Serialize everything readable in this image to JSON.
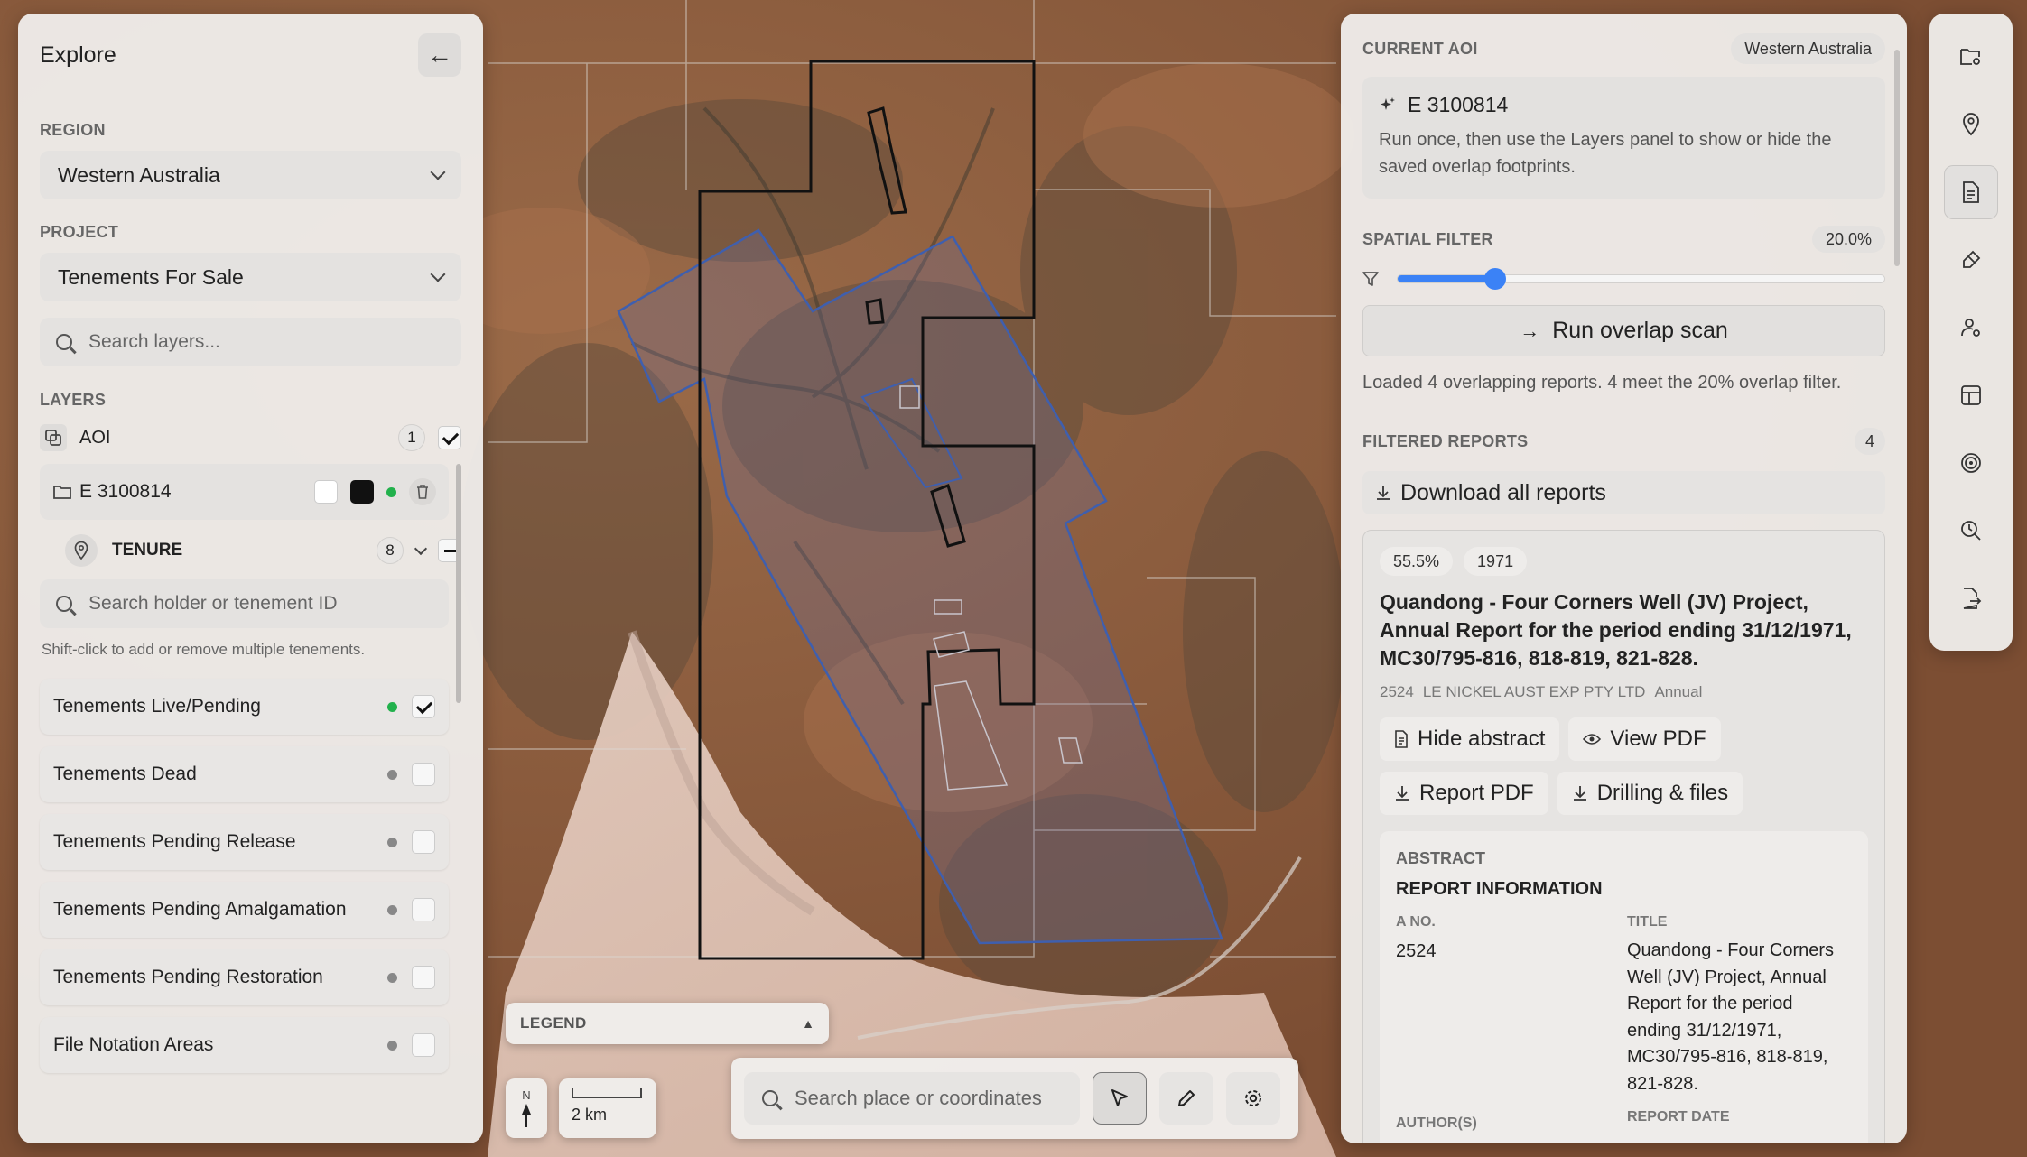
{
  "left_panel": {
    "title": "Explore",
    "region_label": "REGION",
    "region_value": "Western Australia",
    "project_label": "PROJECT",
    "project_value": "Tenements For Sale",
    "search_layers_placeholder": "Search layers...",
    "layers_label": "LAYERS",
    "aoi": {
      "label": "AOI",
      "count": "1",
      "item": "E 3100814"
    },
    "tenure": {
      "label": "TENURE",
      "count": "8",
      "search_placeholder": "Search holder or tenement ID",
      "hint": "Shift-click to add or remove multiple tenements."
    },
    "layers": [
      {
        "label": "Tenements Live/Pending",
        "dot": "#22b14c",
        "checked": true
      },
      {
        "label": "Tenements Dead",
        "dot": "#888888",
        "checked": false
      },
      {
        "label": "Tenements Pending Release",
        "dot": "#888888",
        "checked": false
      },
      {
        "label": "Tenements Pending Amalgamation",
        "dot": "#888888",
        "checked": false
      },
      {
        "label": "Tenements Pending Restoration",
        "dot": "#888888",
        "checked": false
      },
      {
        "label": "File Notation Areas",
        "dot": "#888888",
        "checked": false
      }
    ]
  },
  "map": {
    "legend_label": "LEGEND",
    "north_label": "N",
    "scale_label": "2 km",
    "search_placeholder": "Search place or coordinates"
  },
  "right_panel": {
    "current_aoi_label": "CURRENT AOI",
    "region_pill": "Western Australia",
    "aoi_name": "E 3100814",
    "aoi_hint": "Run once, then use the Layers panel to show or hide the saved overlap footprints.",
    "spatial_filter_label": "SPATIAL FILTER",
    "spatial_filter_value": "20.0%",
    "spatial_filter_fraction": 0.2,
    "run_button": "Run overlap scan",
    "status_text": "Loaded 4 overlapping reports. 4 meet the 20% overlap filter.",
    "filtered_label": "FILTERED REPORTS",
    "filtered_count": "4",
    "download_all": "Download all reports",
    "report": {
      "overlap": "55.5%",
      "year": "1971",
      "title": "Quandong - Four Corners Well (JV) Project, Annual Report for the period ending 31/12/1971, MC30/795-816, 818-819, 821-828.",
      "id": "2524",
      "company": "LE NICKEL AUST EXP PTY LTD",
      "type": "Annual",
      "hide_abstract": "Hide abstract",
      "view_pdf": "View PDF",
      "report_pdf": "Report PDF",
      "drilling": "Drilling & files",
      "abstract_label": "ABSTRACT",
      "info_heading": "REPORT INFORMATION",
      "a_no_label": "A NO.",
      "a_no_value": "2524",
      "title_label": "TITLE",
      "title_value": "Quandong - Four Corners Well (JV) Project, Annual Report for the period ending 31/12/1971, MC30/795-816, 818-819, 821-828.",
      "authors_label": "AUTHOR(S)",
      "report_date_label": "REPORT DATE"
    }
  },
  "rail_icons": [
    "folder-gear-icon",
    "map-pin-icon",
    "document-icon",
    "paint-brush-icon",
    "user-gear-icon",
    "table-icon",
    "target-icon",
    "search-clock-icon",
    "file-export-icon"
  ]
}
